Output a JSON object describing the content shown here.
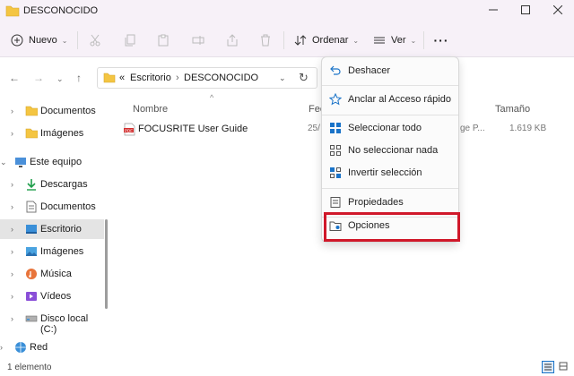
{
  "window": {
    "title": "DESCONOCIDO"
  },
  "toolbar": {
    "new_label": "Nuevo",
    "sort_label": "Ordenar",
    "view_label": "Ver"
  },
  "address": {
    "overflow": "«",
    "crumbs": [
      "Escritorio",
      "DESCONOCIDO"
    ],
    "separator": "›"
  },
  "sidebar": {
    "items": [
      {
        "label": "Documentos",
        "icon": "folder-icon"
      },
      {
        "label": "Imágenes",
        "icon": "folder-icon"
      },
      {
        "label": "Este equipo",
        "icon": "computer-icon"
      },
      {
        "label": "Descargas",
        "icon": "download-icon"
      },
      {
        "label": "Documentos",
        "icon": "document-icon"
      },
      {
        "label": "Escritorio",
        "icon": "desktop-icon",
        "selected": true
      },
      {
        "label": "Imágenes",
        "icon": "pictures-icon"
      },
      {
        "label": "Música",
        "icon": "music-icon"
      },
      {
        "label": "Vídeos",
        "icon": "video-icon"
      },
      {
        "label": "Disco local (C:)",
        "icon": "drive-icon"
      },
      {
        "label": "Red",
        "icon": "network-icon"
      }
    ]
  },
  "columns": {
    "name": "Nombre",
    "date": "Fec",
    "size": "Tamaño"
  },
  "file": {
    "name": "FOCUSRITE User Guide",
    "icon_text": "PDF",
    "date_partial": "25/",
    "type_partial": "ge P...",
    "size": "1.619 KB"
  },
  "menu": {
    "items": [
      {
        "label": "Deshacer",
        "icon": "undo-icon"
      },
      {
        "label": "Anclar al Acceso rápido",
        "icon": "star-icon"
      },
      {
        "label": "Seleccionar todo",
        "icon": "select-all-icon"
      },
      {
        "label": "No seleccionar nada",
        "icon": "select-none-icon"
      },
      {
        "label": "Invertir selección",
        "icon": "invert-selection-icon"
      },
      {
        "label": "Propiedades",
        "icon": "properties-icon"
      },
      {
        "label": "Opciones",
        "icon": "options-icon"
      }
    ]
  },
  "status": {
    "count": "1 elemento"
  },
  "colors": {
    "accent": "#1a73c8",
    "highlight_border": "#d0182a",
    "folder": "#f4c542",
    "pdf_red": "#d32f2f"
  }
}
